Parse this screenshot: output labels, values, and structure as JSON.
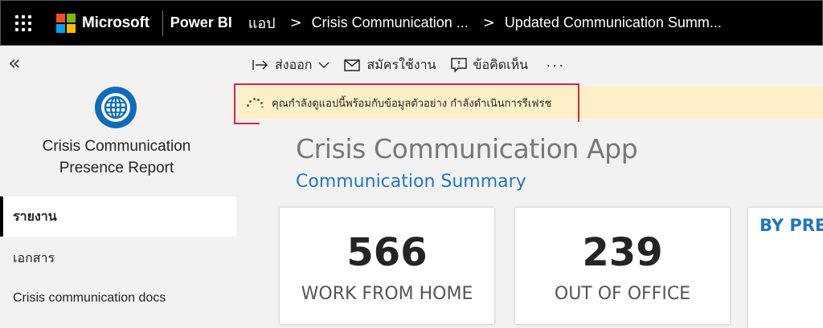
{
  "topbar": {
    "brand": "Microsoft",
    "product": "Power BI",
    "breadcrumbs": [
      "แอป",
      "Crisis Communication ...",
      "Updated Communication Summ..."
    ],
    "crumb_separator": ">"
  },
  "leftnav": {
    "collapse_glyph": "«",
    "app_title_line1": "Crisis Communication",
    "app_title_line2": "Presence Report",
    "items": [
      {
        "label": "รายงาน",
        "active": true
      },
      {
        "label": "เอกสาร",
        "active": false
      },
      {
        "label": "Crisis communication docs",
        "active": false
      }
    ]
  },
  "toolbar": {
    "export_label": "ส่งออก",
    "subscribe_label": "สมัครใช้งาน",
    "comments_label": "ข้อคิดเห็น",
    "more_label": "···"
  },
  "notice": {
    "text": "คุณกำลังดูแอปนี้พร้อมกับข้อมูลตัวอย่าง กำลังดำเนินการรีเฟรช"
  },
  "report": {
    "title": "Crisis Communication App",
    "subtitle": "Communication Summary",
    "cards": [
      {
        "value": "566",
        "label": "WORK FROM HOME"
      },
      {
        "value": "239",
        "label": "OUT OF OFFICE"
      }
    ],
    "partial_card_heading": "BY PRE"
  },
  "colors": {
    "accent_blue": "#1f77c4",
    "notice_bg": "#fdf0c6",
    "highlight_red": "#e0243c",
    "topbar_bg": "#000000"
  }
}
